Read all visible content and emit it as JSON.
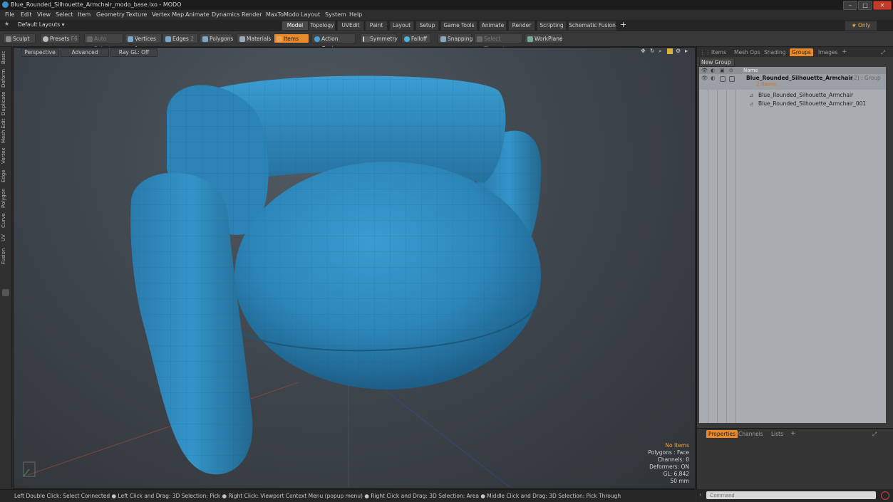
{
  "window": {
    "title": "Blue_Rounded_Silhouette_Armchair_modo_base.lxo - MODO",
    "controls": [
      "–",
      "□",
      "✕"
    ]
  },
  "menu": [
    "File",
    "Edit",
    "View",
    "Select",
    "Item",
    "Geometry",
    "Texture",
    "Vertex Map",
    "Animate",
    "Dynamics",
    "Render",
    "MaxToModo",
    "Layout",
    "System",
    "Help"
  ],
  "layouts": {
    "default_label": "Default Layouts ▾",
    "tabs": [
      "Model",
      "Topology",
      "UVEdit",
      "Paint",
      "Layout",
      "Setup",
      "Game Tools",
      "Animate",
      "Render",
      "Scripting",
      "Schematic Fusion"
    ],
    "active_tab": "Model",
    "add": "+",
    "only_label": "★  Only"
  },
  "toolbar": {
    "sculpt": "Sculpt",
    "presets": "Presets",
    "presets_key": "F6",
    "auto_select": "Auto Select",
    "vertices": "Vertices",
    "vertices_key": "1",
    "edges": "Edges",
    "edges_key": "2",
    "polygons": "Polygons",
    "materials": "Materials",
    "items": "Items",
    "action_center": "Action Center",
    "symmetry": "Symmetry",
    "falloff": "Falloff",
    "snapping": "Snapping",
    "select_through": "Select Through",
    "workplane": "WorkPlane"
  },
  "left_tabs": [
    "Basic",
    "Deform",
    "Duplicate",
    "Mesh Edit",
    "Vertex",
    "Edge",
    "Polygon",
    "Curve",
    "UV",
    "Fusion"
  ],
  "viewport": {
    "view": "Perspective",
    "shading": "Advanced",
    "raygl": "Ray GL: Off",
    "info": {
      "items": "No Items",
      "polygons": "Polygons : Face",
      "channels": "Channels: 0",
      "deformers": "Deformers: ON",
      "gl": "GL: 6,842",
      "focal": "50 mm"
    },
    "object_color": "#2f86b8"
  },
  "statusbar": "Left Double Click: Select Connected ● Left Click and Drag: 3D Selection: Pick ● Right Click: Viewport Context Menu (popup menu) ● Right Click and Drag: 3D Selection: Area ● Middle Click and Drag: 3D Selection: Pick Through",
  "right_panel": {
    "tabs": [
      "Items",
      "Mesh Ops",
      "Shading",
      "Groups",
      "Images"
    ],
    "active_tab": "Groups",
    "add": "+",
    "new_group": "New Group",
    "column_name": "Name",
    "group": {
      "name": "Blue_Rounded_Silhouette_Armchair",
      "suffix": "(2) : Group",
      "count": "2 Items",
      "children": [
        "Blue_Rounded_Silhouette_Armchair",
        "Blue_Rounded_Silhouette_Armchair_001"
      ]
    }
  },
  "properties_panel": {
    "tabs": [
      "Properties",
      "Channels",
      "Lists"
    ],
    "active_tab": "Properties",
    "add": "+"
  },
  "command": {
    "placeholder": "Command"
  },
  "accent_color": "#e8892a"
}
